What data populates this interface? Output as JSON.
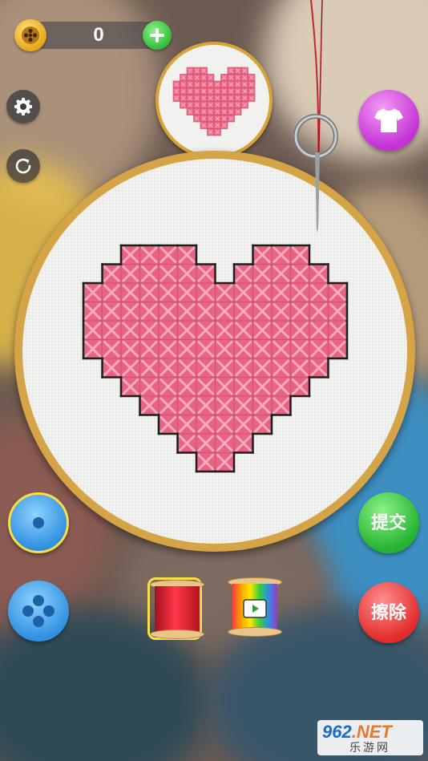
{
  "coins": {
    "count": "0",
    "icon": "coin-icon",
    "add_icon": "plus-icon"
  },
  "toolbar": {
    "settings_icon": "gear-icon",
    "restart_icon": "restart-icon",
    "shirt_icon": "shirt-icon"
  },
  "pattern": {
    "name_icon": "heart-pattern",
    "color": "#ee6b8a",
    "rows": [
      "..###...###.",
      ".#####.#####",
      "############",
      "############",
      "############",
      ".##########.",
      "..########..",
      "...######...",
      "....####....",
      ".....##....."
    ]
  },
  "stitched": {
    "color": "#e96385",
    "rows": [
      "..####...###..",
      ".######.#####.",
      "##############",
      "##############",
      "##############",
      "##############",
      ".############.",
      "..##########..",
      "...########...",
      "....######....",
      ".....####.....",
      "......##......"
    ]
  },
  "tools": {
    "single_stitch_icon": "single-hole-button-icon",
    "multi_stitch_icon": "four-hole-button-icon",
    "thread_red_icon": "red-thread-spool",
    "thread_video_icon": "rainbow-thread-video-spool"
  },
  "actions": {
    "submit": "提交",
    "erase": "擦除"
  },
  "watermark": {
    "brand_prefix": "962",
    "brand_suffix": ".NET",
    "subtitle": "乐游网"
  },
  "colors": {
    "hoop": "#d4a446",
    "accent_green": "#2fbf3b",
    "accent_red": "#e22d2d",
    "accent_purple": "#c431d6",
    "accent_blue": "#2f8fe0"
  }
}
